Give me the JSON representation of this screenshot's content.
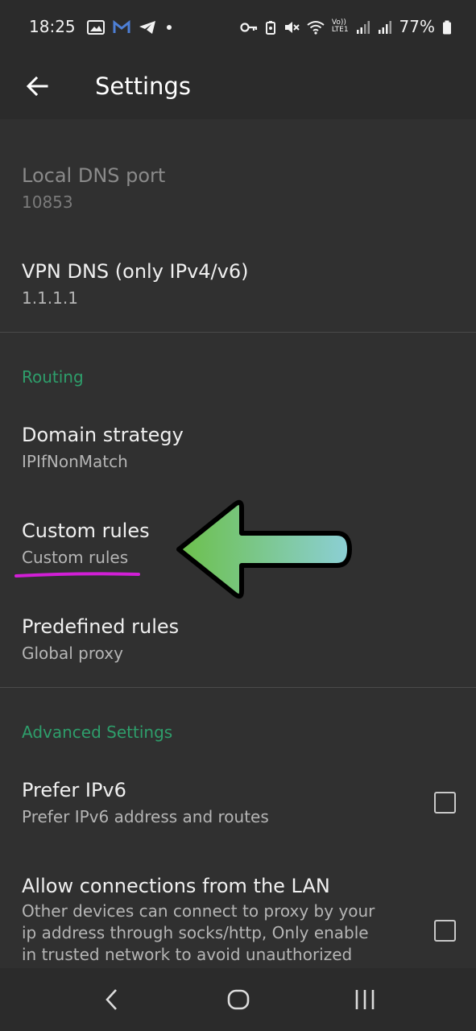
{
  "status_bar": {
    "time": "18:25",
    "battery": "77%",
    "left_icons": [
      "image-icon",
      "gmail-icon",
      "telegram-icon",
      "dot-icon"
    ],
    "right_icons": [
      "key-icon",
      "battery-saver-icon",
      "mute-icon",
      "wifi-icon",
      "volte-icon",
      "signal-icon",
      "signal-icon",
      "battery-icon"
    ],
    "volte_label_top": "Vo))",
    "volte_label_bottom": "LTE1"
  },
  "app_bar": {
    "title": "Settings",
    "back_icon": "back-arrow-icon"
  },
  "settings": {
    "local_dns": {
      "title": "Local DNS port",
      "value": "10853",
      "enabled": false
    },
    "vpn_dns": {
      "title": "VPN DNS (only IPv4/v6)",
      "value": "1.1.1.1"
    },
    "routing_header": "Routing",
    "domain_strategy": {
      "title": "Domain strategy",
      "value": "IPIfNonMatch"
    },
    "custom_rules": {
      "title": "Custom rules",
      "value": "Custom rules"
    },
    "predefined_rules": {
      "title": "Predefined rules",
      "value": "Global proxy"
    },
    "advanced_header": "Advanced Settings",
    "prefer_ipv6": {
      "title": "Prefer IPv6",
      "value": "Prefer IPv6 address and routes",
      "checked": false
    },
    "allow_lan": {
      "title": "Allow connections from the LAN",
      "line1": "Other devices can connect to proxy by your",
      "line2": "ip address through socks/http, Only enable",
      "line3": "in trusted network to avoid unauthorized",
      "checked": false
    }
  },
  "nav_bar": {
    "buttons": [
      "back-icon",
      "home-icon",
      "recents-icon"
    ]
  },
  "colors": {
    "accent": "#2e9e6b",
    "annotation_arrow_start": "#6cc04a",
    "annotation_arrow_end": "#8ccfd6",
    "annotation_underline": "#d11fd6",
    "background": "#303030"
  }
}
